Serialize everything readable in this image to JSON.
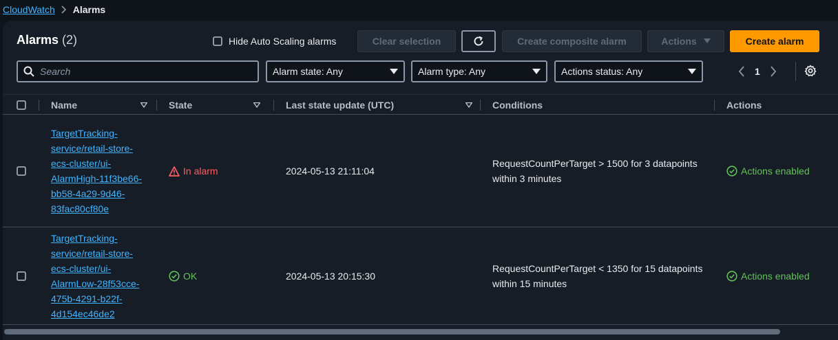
{
  "breadcrumb": {
    "root": "CloudWatch",
    "current": "Alarms"
  },
  "header": {
    "title": "Alarms",
    "count": "(2)",
    "hide_autoscaling_label": "Hide Auto Scaling alarms",
    "clear_selection": "Clear selection",
    "create_composite": "Create composite alarm",
    "actions": "Actions",
    "create_alarm": "Create alarm"
  },
  "filters": {
    "search_placeholder": "Search",
    "alarm_state": "Alarm state: Any",
    "alarm_type": "Alarm type: Any",
    "actions_status": "Actions status: Any"
  },
  "pagination": {
    "current_page": "1"
  },
  "table": {
    "columns": [
      "Name",
      "State",
      "Last state update (UTC)",
      "Conditions",
      "Actions"
    ],
    "rows": [
      {
        "name": "TargetTracking-service/retail-store-ecs-cluster/ui-AlarmHigh-11f3be66-bb58-4a29-9d46-83fac80cf80e",
        "state": "In alarm",
        "last_update": "2024-05-13 21:11:04",
        "conditions": "RequestCountPerTarget > 1500 for 3 datapoints within 3 minutes",
        "actions": "Actions enabled"
      },
      {
        "name": "TargetTracking-service/retail-store-ecs-cluster/ui-AlarmLow-28f53cce-475b-4291-b22f-4d154ec46de2",
        "state": "OK",
        "last_update": "2024-05-13 20:15:30",
        "conditions": "RequestCountPerTarget < 1350 for 15 datapoints within 15 minutes",
        "actions": "Actions enabled"
      }
    ]
  },
  "colors": {
    "accent": "#ff9900",
    "link": "#42b4ff",
    "alarm": "#ff5d64",
    "ok": "#62c25a"
  }
}
